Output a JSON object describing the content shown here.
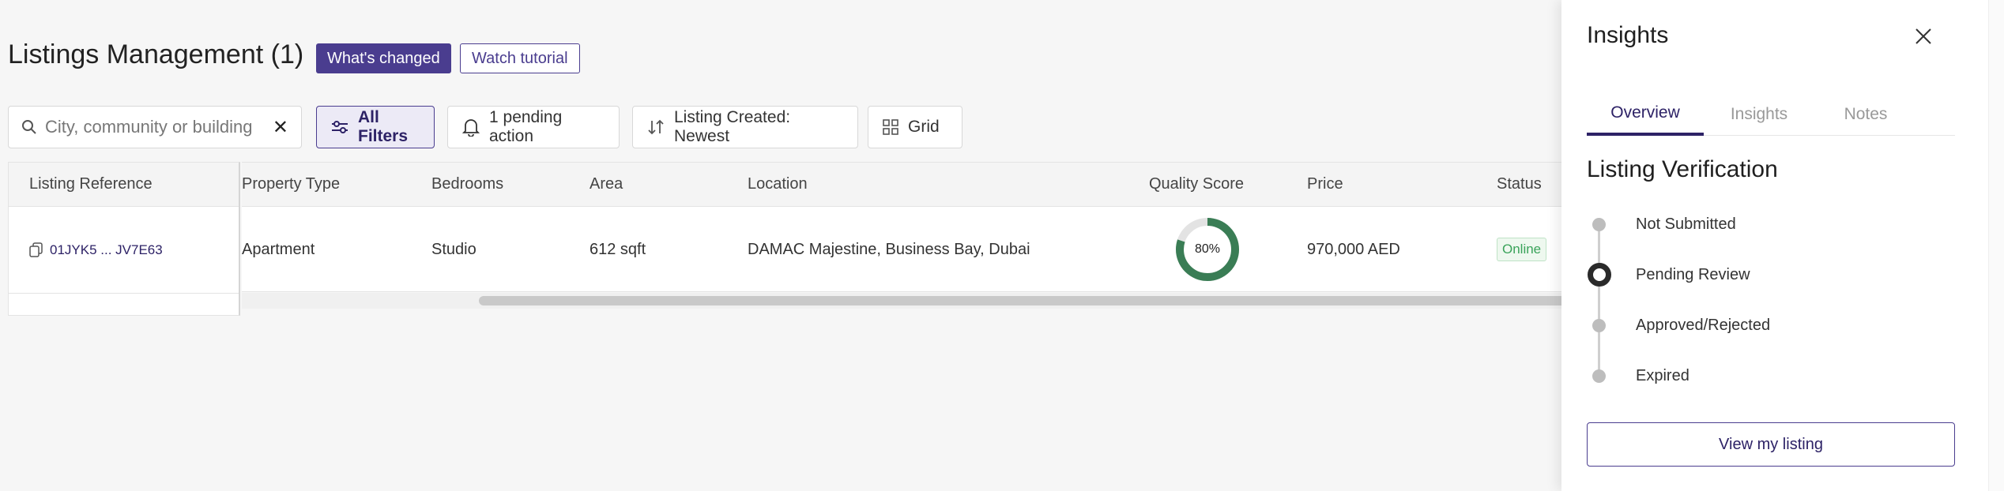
{
  "header": {
    "title": "Listings Management (1)",
    "whats_changed": "What's changed",
    "watch_tutorial": "Watch tutorial"
  },
  "toolbar": {
    "search_placeholder": "City, community or building",
    "all_filters": "All Filters",
    "pending_action": "1 pending action",
    "sort": "Listing Created: Newest",
    "view_mode": "Grid"
  },
  "table": {
    "fixed_header": "Listing Reference",
    "columns": [
      "Property Type",
      "Bedrooms",
      "Area",
      "Location",
      "Quality Score",
      "Price",
      "Status"
    ],
    "rows": [
      {
        "reference": "01JYK5 ... JV7E63",
        "property_type": "Apartment",
        "bedrooms": "Studio",
        "area": "612 sqft",
        "location": "DAMAC Majestine, Business Bay, Dubai",
        "quality_score": "80%",
        "quality_value": 80,
        "price": "970,000 AED",
        "status": "Online"
      }
    ]
  },
  "panel": {
    "title": "Insights",
    "tabs": [
      "Overview",
      "Insights",
      "Notes"
    ],
    "active_tab": "Overview",
    "section_title": "Listing Verification",
    "steps": [
      "Not Submitted",
      "Pending Review",
      "Approved/Rejected",
      "Expired"
    ],
    "current_step": "Pending Review",
    "view_button": "View my listing"
  },
  "colors": {
    "brand": "#4a3d8f",
    "quality_ring": "#3a7d55",
    "online": "#3aa35a"
  }
}
